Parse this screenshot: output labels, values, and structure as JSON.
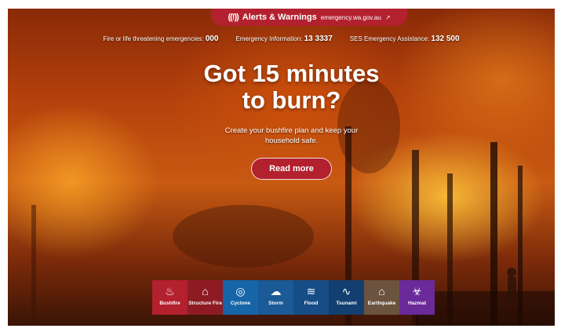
{
  "alert_bar": {
    "title": "Alerts & Warnings",
    "url": "emergency.wa.gov.au",
    "color": "#b3202e",
    "icon": "alert-broadcast-icon",
    "external_icon": "external-link-icon"
  },
  "contacts": [
    {
      "label": "Fire or life threatening emergencies:",
      "number": "000"
    },
    {
      "label": "Emergency Information:",
      "number": "13 3337"
    },
    {
      "label": "SES Emergency Assistance:",
      "number": "132 500"
    }
  ],
  "hero": {
    "title_line1": "Got 15 minutes",
    "title_line2": "to burn?",
    "subtitle_line1": "Create your bushfire plan and keep your",
    "subtitle_line2": "household safe.",
    "cta_label": "Read more"
  },
  "hazards": [
    {
      "label": "Bushfire",
      "icon": "flame-icon",
      "color": "#b3202e"
    },
    {
      "label": "Structure Fire",
      "icon": "house-fire-icon",
      "color": "#8e1b24"
    },
    {
      "label": "Cyclone",
      "icon": "cyclone-icon",
      "color": "#1565a8"
    },
    {
      "label": "Storm",
      "icon": "storm-cloud-icon",
      "color": "#1a5a96"
    },
    {
      "label": "Flood",
      "icon": "flood-waves-icon",
      "color": "#164d86"
    },
    {
      "label": "Tsunami",
      "icon": "wave-icon",
      "color": "#123f70"
    },
    {
      "label": "Earthquake",
      "icon": "earthquake-house-icon",
      "color": "#6b5340"
    },
    {
      "label": "Hazmat",
      "icon": "biohazard-icon",
      "color": "#6a2a9a"
    }
  ]
}
